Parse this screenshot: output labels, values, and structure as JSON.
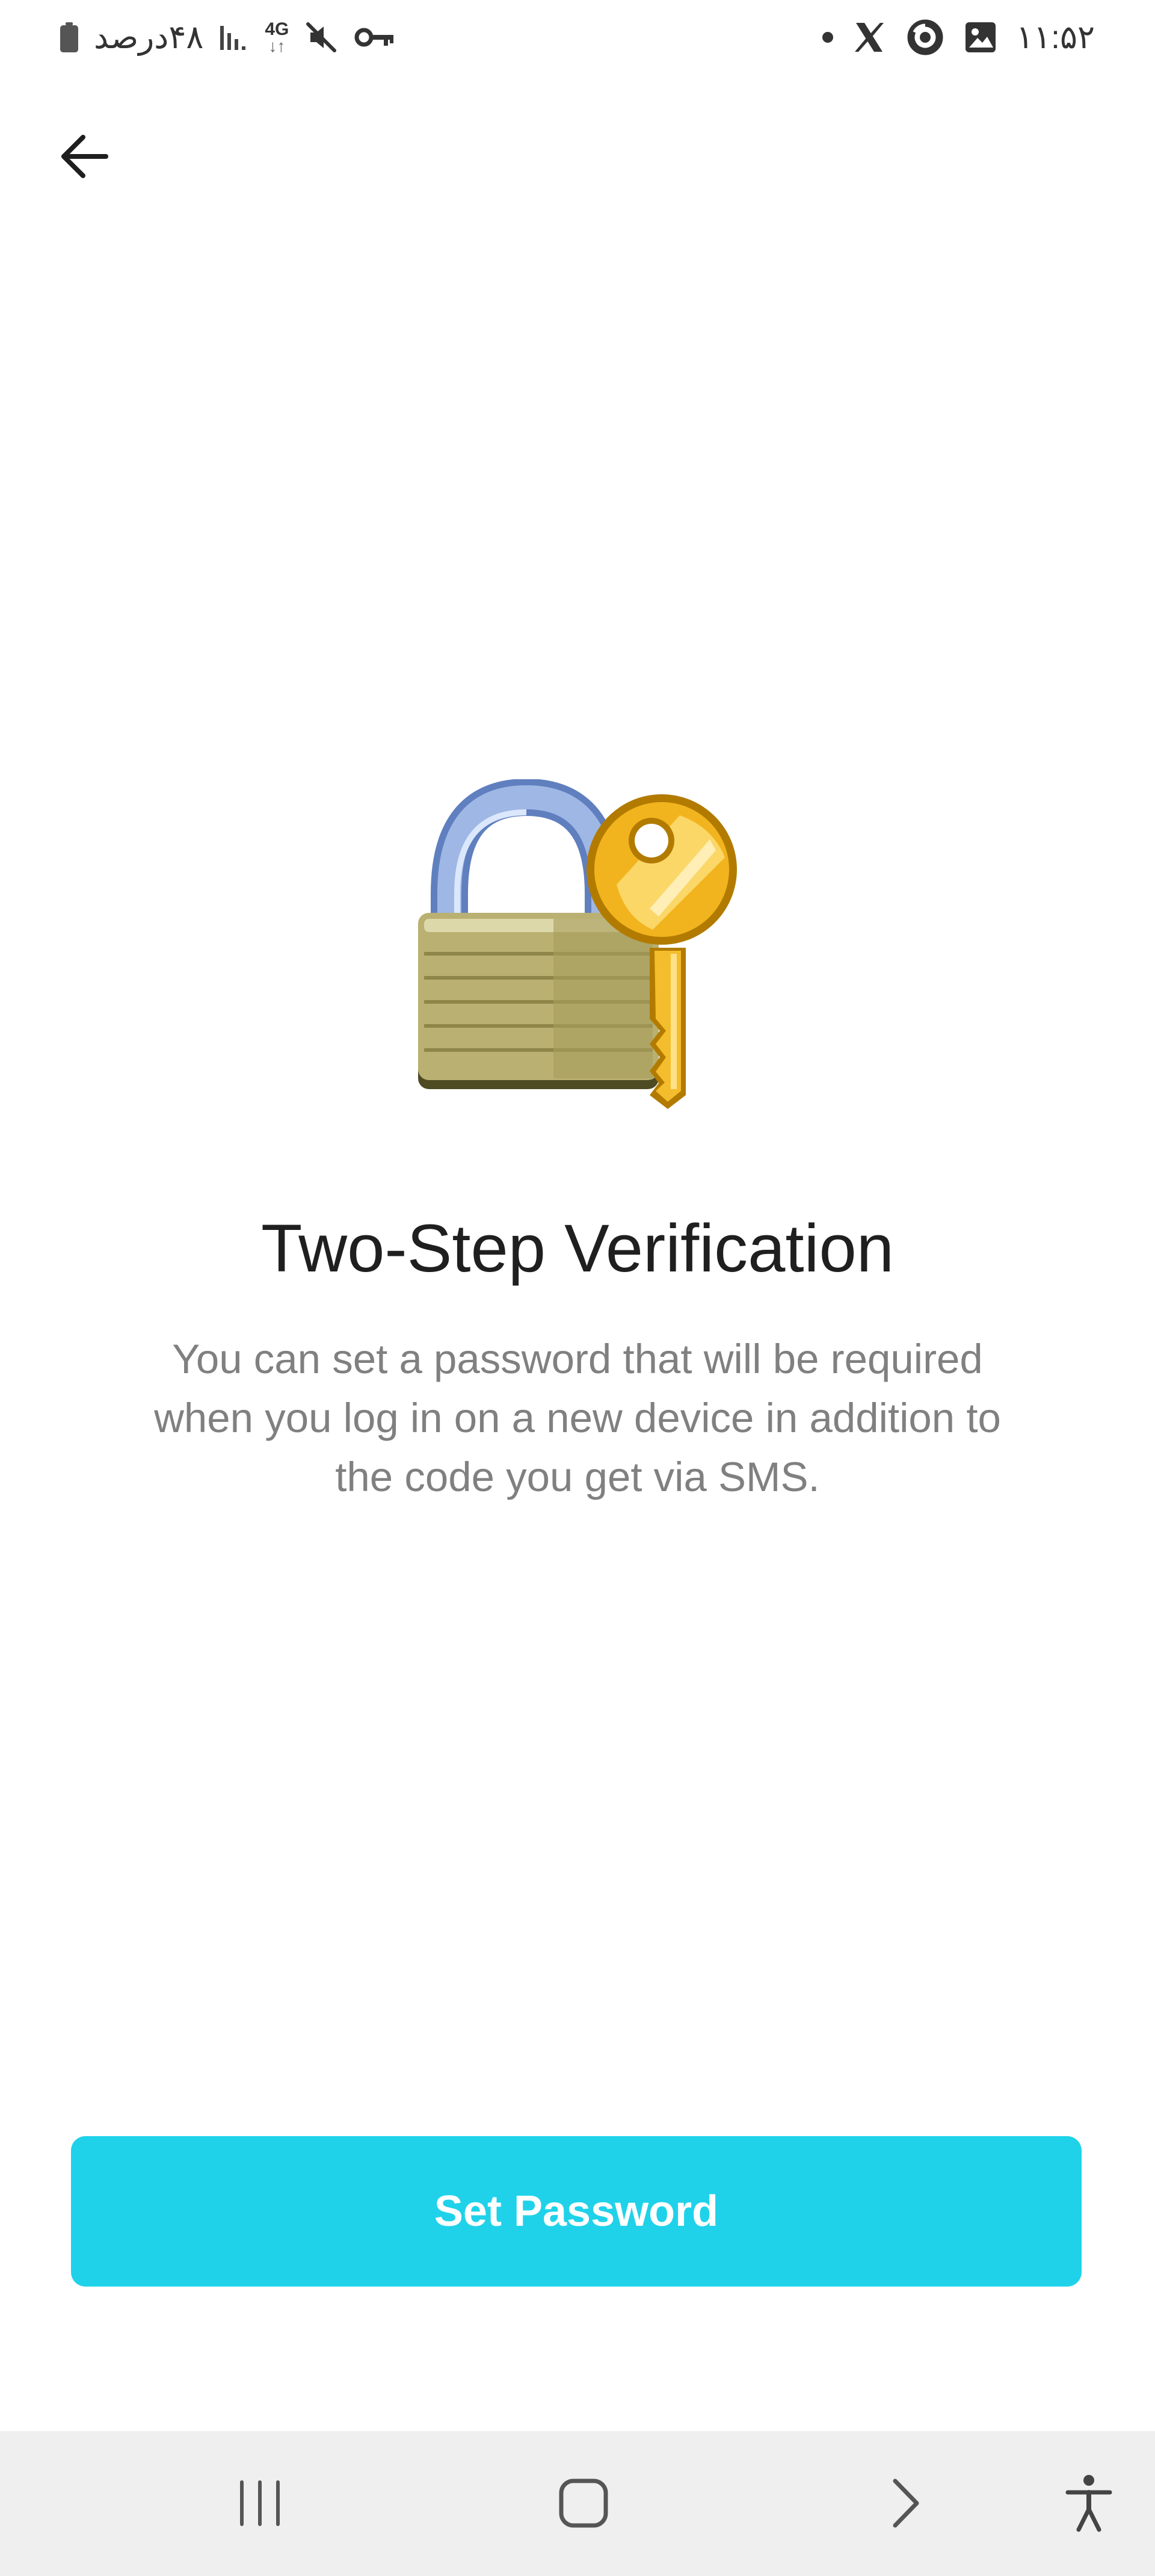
{
  "status_bar": {
    "battery_text": "۴۸درصد",
    "network_type": "4G",
    "time": "۱۱:۵۲"
  },
  "header": {
    "back_icon": "arrow-left-icon"
  },
  "illustration": {
    "icon": "lock-with-key-icon"
  },
  "main": {
    "title": "Two-Step Verification",
    "description_lines": [
      "You can set a password that will be required",
      "when you log in on a new device in addition to",
      "the code you get via SMS."
    ],
    "set_password_label": "Set Password"
  },
  "colors": {
    "accent": "#1fd2ea",
    "title": "#1f1f1f",
    "description": "#808080",
    "nav_background": "#efefef"
  },
  "nav_bar": {
    "icons": [
      "recents-icon",
      "home-icon",
      "back-chevron-icon",
      "accessibility-icon"
    ]
  }
}
